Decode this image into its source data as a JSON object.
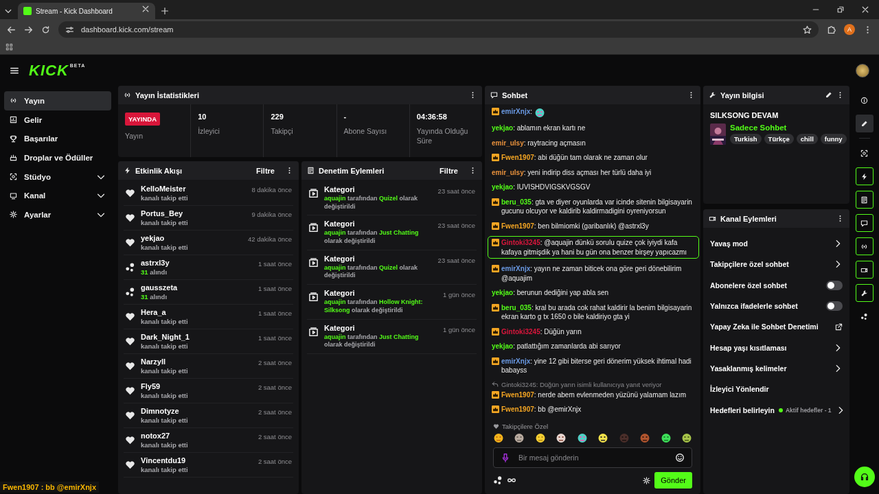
{
  "browser": {
    "tab_title": "Stream - Kick Dashboard",
    "url": "dashboard.kick.com/stream",
    "profile_initial": "A"
  },
  "header": {
    "logo": "KICK",
    "logo_badge": "BETA"
  },
  "sidebar": {
    "items": [
      {
        "label": "Yayın",
        "kind": "link",
        "selected": true
      },
      {
        "label": "Gelir",
        "kind": "link",
        "selected": false
      },
      {
        "label": "Başarılar",
        "kind": "link",
        "selected": false
      },
      {
        "label": "Droplar ve Ödüller",
        "kind": "link",
        "selected": false
      },
      {
        "label": "Stüdyo",
        "kind": "group",
        "selected": false
      },
      {
        "label": "Kanal",
        "kind": "group",
        "selected": false
      },
      {
        "label": "Ayarlar",
        "kind": "group",
        "selected": false
      }
    ]
  },
  "overlay_caption": "Fwen1907 : bb @emirXnjx",
  "stream_stats": {
    "title": "Yayın İstatistikleri",
    "status_badge": "YAYINDA",
    "status_label": "Yayın",
    "stats": [
      {
        "value": "10",
        "label": "İzleyici"
      },
      {
        "value": "229",
        "label": "Takipçi"
      },
      {
        "value": "-",
        "label": "Abone Sayısı"
      },
      {
        "value": "04:36:58",
        "label": "Yayında Olduğu Süre"
      }
    ]
  },
  "event_feed": {
    "title": "Etkinlik Akışı",
    "filter": "Filtre",
    "events": [
      {
        "kind": "follow",
        "user": "KelloMeister",
        "detail": "kanalı takip etti",
        "time": "8 dakika önce"
      },
      {
        "kind": "follow",
        "user": "Portus_Bey",
        "detail": "kanalı takip etti",
        "time": "9 dakika önce"
      },
      {
        "kind": "follow",
        "user": "yekjao",
        "detail": "kanalı takip etti",
        "time": "42 dakika önce"
      },
      {
        "kind": "kicks",
        "user": "astrxl3y",
        "amount": "31",
        "detail": "alındı",
        "time": "1 saat önce"
      },
      {
        "kind": "kicks",
        "user": "gausszeta",
        "amount": "31",
        "detail": "alındı",
        "time": "1 saat önce"
      },
      {
        "kind": "follow",
        "user": "Hera_a",
        "detail": "kanalı takip etti",
        "time": "1 saat önce"
      },
      {
        "kind": "follow",
        "user": "Dark_Night_1",
        "detail": "kanalı takip etti",
        "time": "1 saat önce"
      },
      {
        "kind": "follow",
        "user": "Narzyll",
        "detail": "kanalı takip etti",
        "time": "2 saat önce"
      },
      {
        "kind": "follow",
        "user": "Fly59",
        "detail": "kanalı takip etti",
        "time": "2 saat önce"
      },
      {
        "kind": "follow",
        "user": "Dimnotyze",
        "detail": "kanalı takip etti",
        "time": "2 saat önce"
      },
      {
        "kind": "follow",
        "user": "notox27",
        "detail": "kanalı takip etti",
        "time": "2 saat önce"
      },
      {
        "kind": "follow",
        "user": "Vincentdu19",
        "detail": "kanalı takip etti",
        "time": "2 saat önce"
      }
    ]
  },
  "moderation": {
    "title": "Denetim Eylemleri",
    "filter": "Filtre",
    "actions": [
      {
        "title": "Kategori",
        "time": "23 saat önce",
        "actor": "aquajin",
        "by": "tarafından",
        "category": "Quizel",
        "result": "olarak değiştirildi"
      },
      {
        "title": "Kategori",
        "time": "23 saat önce",
        "actor": "aquajin",
        "by": "tarafından",
        "category": "Just Chatting",
        "result": "olarak değiştirildi"
      },
      {
        "title": "Kategori",
        "time": "23 saat önce",
        "actor": "aquajin",
        "by": "tarafından",
        "category": "Quizel",
        "result": "olarak değiştirildi"
      },
      {
        "title": "Kategori",
        "time": "1 gün önce",
        "actor": "aquajin",
        "by": "tarafından",
        "category": "Hollow Knight: Silksong",
        "result": "olarak değiştirildi"
      },
      {
        "title": "Kategori",
        "time": "1 gün önce",
        "actor": "aquajin",
        "by": "tarafından",
        "category": "Just Chatting",
        "result": "olarak değiştirildi"
      }
    ]
  },
  "chat": {
    "title": "Sohbet",
    "messages": [
      {
        "user": "emirXnjx",
        "color": "#6b9be6",
        "badge": true,
        "kind": "emote",
        "text": ":",
        "highlighted": false
      },
      {
        "user": "yekjao",
        "color": "#53fc18",
        "badge": false,
        "kind": "text",
        "text": ": ablamın ekran kartı ne",
        "highlighted": false
      },
      {
        "user": "emir_ulsy",
        "color": "#e8913c",
        "badge": false,
        "kind": "text",
        "text": ": raytracing açmasın",
        "highlighted": false
      },
      {
        "user": "Fwen1907",
        "color": "#f5a623",
        "badge": true,
        "kind": "text",
        "text": ": abi düğün tam olarak ne zaman olur",
        "highlighted": false
      },
      {
        "user": "emir_ulsy",
        "color": "#e8913c",
        "badge": false,
        "kind": "text",
        "text": ": yeni indirip diss açması her türlü daha iyi",
        "highlighted": false
      },
      {
        "user": "yekjao",
        "color": "#53fc18",
        "badge": false,
        "kind": "text",
        "text": ": IUVISHDVIGSKVGSGV",
        "highlighted": false
      },
      {
        "user": "beru_035",
        "color": "#53fc18",
        "badge": true,
        "kind": "text",
        "text": ": gta ve diyer oyunlarda var icinde sitenin bilgisayarin gucunu olcuyor ve kaldirib kaldirmadigini oyreniyorsun",
        "highlighted": false
      },
      {
        "user": "Fwen1907",
        "color": "#f5a623",
        "badge": true,
        "kind": "text",
        "text": ": ben bilmiomki (garibanlık) @astrxl3y",
        "highlighted": false
      },
      {
        "user": "Gintoki3245",
        "color": "#d9163c",
        "badge": true,
        "kind": "text",
        "text": ": @aquajin dünkü sorulu quize çok iyiydi kafa kafaya gitmişdik ya hani bu gün ona benzer birşey yapıcazmı",
        "highlighted": true
      },
      {
        "user": "emirXnjx",
        "color": "#6b9be6",
        "badge": true,
        "kind": "text",
        "text": ": yayın ne zaman biticek ona göre geri dönebilirim @aquajim",
        "highlighted": false
      },
      {
        "user": "yekjao",
        "color": "#53fc18",
        "badge": false,
        "kind": "text",
        "text": ": berunun dediğini yap abla sen",
        "highlighted": false
      },
      {
        "user": "beru_035",
        "color": "#53fc18",
        "badge": true,
        "kind": "text",
        "text": ": kral bu arada cok rahat kaldirir la benim bilgisayarin ekran karto g tx 1650 o bile kaldiriyo gta yi",
        "highlighted": false
      },
      {
        "user": "Gintoki3245",
        "color": "#d9163c",
        "badge": true,
        "kind": "text",
        "text": ": Düğün yarın",
        "highlighted": false
      },
      {
        "user": "yekjao",
        "color": "#53fc18",
        "badge": false,
        "kind": "text",
        "text": ": patlattığım zamanlarda abi sarıyor",
        "highlighted": false
      },
      {
        "user": "emirXnjx",
        "color": "#6b9be6",
        "badge": true,
        "kind": "text",
        "text": ": yine 12 gibi biterse geri dönerim yüksek ihtimal hadi babayss",
        "highlighted": false
      },
      {
        "user": "Fwen1907",
        "color": "#f5a623",
        "badge": true,
        "kind": "text",
        "text": ": nerde abem evlenmeden yüzünü yalamam lazım",
        "highlighted": false,
        "reply_to": "Gintoki3245: Düğün yarın isimli kullanıcıya yanıt veriyor"
      },
      {
        "user": "Fwen1907",
        "color": "#f5a623",
        "badge": true,
        "kind": "text",
        "text": ": bb @emirXnjx",
        "highlighted": false
      }
    ],
    "emote_section": "Takipçilere Özel",
    "input": {
      "placeholder": "Bir mesaj gönderin"
    },
    "send": "Gönder"
  },
  "stream_info": {
    "title": "Yayın bilgisi",
    "stream_title": "SILKSONG DEVAM",
    "category": "Sadece Sohbet",
    "tags": [
      "Turkish",
      "Türkçe",
      "chill",
      "funny"
    ]
  },
  "channel_actions": {
    "title": "Kanal Eylemleri",
    "items": [
      {
        "label": "Yavaş mod",
        "kind": "link"
      },
      {
        "label": "Takipçilere özel sohbet",
        "kind": "link"
      },
      {
        "label": "Abonelere özel sohbet",
        "kind": "toggle",
        "on": false
      },
      {
        "label": "Yalnızca ifadelerle sohbet",
        "kind": "toggle",
        "on": false
      },
      {
        "label": "Yapay Zeka ile Sohbet Denetimi",
        "kind": "external"
      },
      {
        "label": "Hesap yaşı kısıtlaması",
        "kind": "link"
      },
      {
        "label": "Yasaklanmış kelimeler",
        "kind": "link"
      },
      {
        "label": "İzleyici Yönlendir",
        "kind": "plain"
      },
      {
        "label": "Hedefleri belirleyin",
        "kind": "goal",
        "status": "Aktif hedefler - 1"
      }
    ]
  },
  "rail": [
    {
      "kind": "info",
      "selected": false,
      "on": false
    },
    {
      "kind": "edit",
      "selected": true,
      "on": false
    },
    {
      "kind": "scan",
      "selected": false,
      "on": false
    },
    {
      "kind": "bolt",
      "selected": false,
      "on": true
    },
    {
      "kind": "doc",
      "selected": false,
      "on": true
    },
    {
      "kind": "chat",
      "selected": false,
      "on": true
    },
    {
      "kind": "broadcast",
      "selected": false,
      "on": true
    },
    {
      "kind": "camera",
      "selected": false,
      "on": true
    },
    {
      "kind": "wrench",
      "selected": false,
      "on": true
    },
    {
      "kind": "kicks",
      "selected": false,
      "on": false
    }
  ]
}
